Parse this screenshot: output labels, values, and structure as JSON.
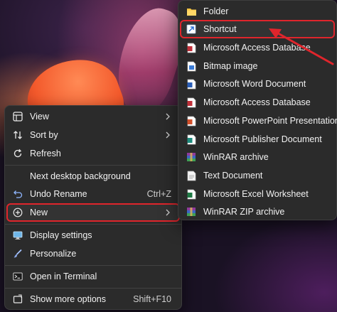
{
  "context_menu": {
    "items": [
      {
        "label": "View",
        "icon": "view-grid-icon",
        "has_submenu": true
      },
      {
        "label": "Sort by",
        "icon": "sort-icon",
        "has_submenu": true
      },
      {
        "label": "Refresh",
        "icon": "refresh-icon"
      },
      {
        "label": "Next desktop background"
      },
      {
        "label": "Undo Rename",
        "icon": "undo-icon",
        "shortcut": "Ctrl+Z"
      },
      {
        "label": "New",
        "icon": "plus-circle-icon",
        "has_submenu": true,
        "highlighted": true
      },
      {
        "label": "Display settings",
        "icon": "display-icon"
      },
      {
        "label": "Personalize",
        "icon": "brush-icon"
      },
      {
        "label": "Open in Terminal",
        "icon": "terminal-icon"
      },
      {
        "label": "Show more options",
        "icon": "share-icon",
        "shortcut": "Shift+F10"
      }
    ]
  },
  "new_submenu": {
    "items": [
      {
        "label": "Folder",
        "icon": "folder-icon"
      },
      {
        "label": "Shortcut",
        "icon": "shortcut-icon",
        "highlighted": true
      },
      {
        "label": "Microsoft Access Database",
        "icon": "access-file-icon"
      },
      {
        "label": "Bitmap image",
        "icon": "bitmap-file-icon"
      },
      {
        "label": "Microsoft Word Document",
        "icon": "word-file-icon"
      },
      {
        "label": "Microsoft Access Database",
        "icon": "access-file-icon"
      },
      {
        "label": "Microsoft PowerPoint Presentation",
        "icon": "powerpoint-file-icon"
      },
      {
        "label": "Microsoft Publisher Document",
        "icon": "publisher-file-icon"
      },
      {
        "label": "WinRAR archive",
        "icon": "winrar-icon"
      },
      {
        "label": "Text Document",
        "icon": "text-file-icon"
      },
      {
        "label": "Microsoft Excel Worksheet",
        "icon": "excel-file-icon"
      },
      {
        "label": "WinRAR ZIP archive",
        "icon": "winrar-zip-icon"
      }
    ]
  },
  "colors": {
    "menu_bg": "#2b2b2b",
    "highlight_border": "#e0252c",
    "text": "#f2f2f2"
  }
}
